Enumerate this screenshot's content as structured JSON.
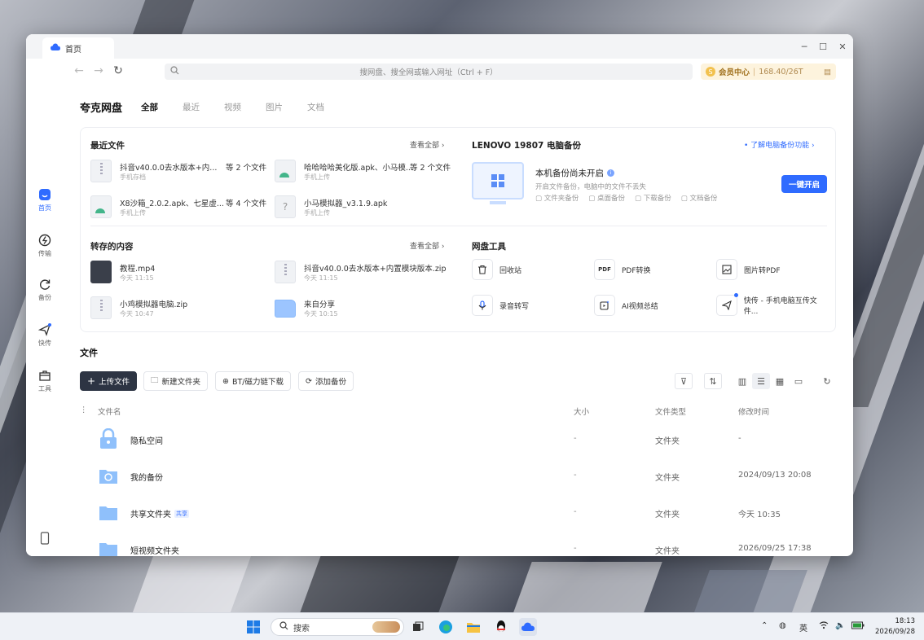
{
  "window": {
    "tab_title": "首页",
    "search_placeholder": "搜网盘、搜全网或输入网址（Ctrl + F）",
    "vip_label": "会员中心",
    "vip_storage": "168.40/26T"
  },
  "sidebar": {
    "items": [
      {
        "label": "首页",
        "icon": "home-icon"
      },
      {
        "label": "传输",
        "icon": "transfer-icon"
      },
      {
        "label": "备份",
        "icon": "backup-icon"
      },
      {
        "label": "快传",
        "icon": "quick-send-icon"
      },
      {
        "label": "工具",
        "icon": "toolbox-icon"
      }
    ]
  },
  "header": {
    "brand": "夸克网盘",
    "tabs": [
      "全部",
      "最近",
      "视频",
      "图片",
      "文档"
    ]
  },
  "recent": {
    "title": "最近文件",
    "view_all": "查看全部",
    "items": [
      {
        "name": "抖音v40.0.0去水版本+内...",
        "extra": "等 2 个文件",
        "sub": "手机存档"
      },
      {
        "name": "哈哈哈哈美化版.apk、小马模...",
        "extra": "等 2 个文件",
        "sub": "手机上传"
      },
      {
        "name": "X8沙箱_2.0.2.apk、七星虚...",
        "extra": "等 4 个文件",
        "sub": "手机上传"
      },
      {
        "name": "小马模拟器_v3.1.9.apk",
        "extra": "",
        "sub": "手机上传"
      }
    ]
  },
  "backup": {
    "title": "LENOVO 19807 电脑备份",
    "learn_link": "了解电脑备份功能",
    "status": "本机备份尚未开启",
    "desc": "开启文件备份，电脑中的文件不丢失",
    "tags": [
      "文件夹备份",
      "桌面备份",
      "下载备份",
      "文档备份"
    ],
    "button": "一键开启"
  },
  "saved": {
    "title": "转存的内容",
    "view_all": "查看全部",
    "items": [
      {
        "name": "教程.mp4",
        "sub": "今天 11:15"
      },
      {
        "name": "抖音v40.0.0去水版本+内置模块版本.zip",
        "sub": "今天 11:15"
      },
      {
        "name": "小鸡模拟器电脑.zip",
        "sub": "今天 10:47"
      },
      {
        "name": "来自分享",
        "sub": "今天 10:15"
      }
    ]
  },
  "tools": {
    "title": "网盘工具",
    "items": [
      {
        "label": "回收站",
        "icon": "trash-icon"
      },
      {
        "label": "PDF转换",
        "icon": "pdf-icon"
      },
      {
        "label": "图片转PDF",
        "icon": "image-to-pdf-icon"
      },
      {
        "label": "录音转写",
        "icon": "microphone-icon"
      },
      {
        "label": "AI视频总结",
        "icon": "ai-video-icon"
      },
      {
        "label": "快传 - 手机电脑互传文件...",
        "icon": "send-icon"
      }
    ]
  },
  "files": {
    "title": "文件",
    "actions": [
      "上传文件",
      "新建文件夹",
      "BT/磁力链下载",
      "添加备份"
    ],
    "columns": [
      "文件名",
      "大小",
      "文件类型",
      "修改时间"
    ],
    "rows": [
      {
        "name": "隐私空间",
        "badge": "",
        "size": "-",
        "type": "文件夹",
        "time": "-"
      },
      {
        "name": "我的备份",
        "badge": "",
        "size": "-",
        "type": "文件夹",
        "time": "2024/09/13 20:08"
      },
      {
        "name": "共享文件夹",
        "badge": "共享",
        "size": "-",
        "type": "文件夹",
        "time": "今天 10:35"
      },
      {
        "name": "短视频文件夹",
        "badge": "",
        "size": "-",
        "type": "文件夹",
        "time": "2026/09/25 17:38"
      }
    ]
  },
  "taskbar": {
    "search": "搜索",
    "ime": "英",
    "time": "18:13",
    "date": "2026/09/28"
  },
  "colors": {
    "accent": "#2f6bff",
    "folder": "#8fc0fb",
    "primary_dark": "#2d3443"
  }
}
